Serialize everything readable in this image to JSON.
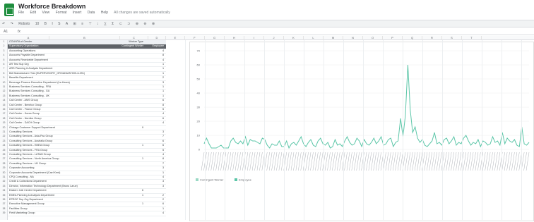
{
  "app": {
    "title": "Workforce Breakdown",
    "menu": [
      "File",
      "Edit",
      "View",
      "Format",
      "Insert",
      "Data",
      "Help"
    ],
    "save_status": "All changes are saved automatically",
    "cell_ref": "A1",
    "fx": "fx"
  },
  "toolbar": {
    "items": [
      "↶",
      "↷",
      "Roboto",
      "10",
      "B",
      "I",
      "S",
      "A",
      "⊞",
      "≡",
      "⊤",
      "↕",
      "∑",
      "Σ",
      "⊂",
      "⊃",
      "⊕",
      "⊖",
      "⊗"
    ]
  },
  "grid": {
    "columns": [
      "A",
      "B",
      "C",
      "D",
      "E",
      "F",
      "G",
      "H",
      "I",
      "J",
      "K",
      "L",
      "M",
      "N",
      "O",
      "P",
      "Q",
      "R",
      "S",
      "T"
    ],
    "rows": [
      {
        "n": "1",
        "a": "COUNTA of Gender",
        "b": "Worker Type",
        "c": ""
      },
      {
        "n": "2",
        "a": "Supervisory Organization",
        "b": "Contingent Worker",
        "c": "Employee"
      },
      {
        "n": "3",
        "a": "Accounting Operations",
        "b": "",
        "c": "4"
      },
      {
        "n": "4",
        "a": "Accounts Payable Department",
        "b": "",
        "c": "8"
      },
      {
        "n": "5",
        "a": "Accounts Receivable Department",
        "b": "",
        "c": "4"
      },
      {
        "n": "6",
        "a": "AR Test Sup Org",
        "b": "",
        "c": "1"
      },
      {
        "n": "7",
        "a": "ARS Planning & Analysis Department",
        "b": "",
        "c": "1"
      },
      {
        "n": "8",
        "a": "Bell Manufacturer Test (SUPERVISORY_ORGANIZATION-6-091)",
        "b": "",
        "c": "1"
      },
      {
        "n": "9",
        "a": "Benefits Department",
        "b": "",
        "c": "2"
      },
      {
        "n": "10",
        "a": "Beverage Finance Executive Department (Ira Heam)",
        "b": "",
        "c": "3"
      },
      {
        "n": "11",
        "a": "Business Services Consulting - FRA",
        "b": "",
        "c": "1"
      },
      {
        "n": "12",
        "a": "Business Services Consulting - GA",
        "b": "",
        "c": "1"
      },
      {
        "n": "13",
        "a": "Business Services Consulting - UK",
        "b": "",
        "c": "1"
      },
      {
        "n": "14",
        "a": "Call Center - AMS Group",
        "b": "",
        "c": "6"
      },
      {
        "n": "15",
        "a": "Call Center - Benelux Group",
        "b": "",
        "c": "8"
      },
      {
        "n": "16",
        "a": "Call Center - France Group",
        "b": "",
        "c": "5"
      },
      {
        "n": "17",
        "a": "Call Center - Korea Group",
        "b": "",
        "c": "4"
      },
      {
        "n": "18",
        "a": "Call Center - Nordics Group",
        "b": "",
        "c": "6"
      },
      {
        "n": "19",
        "a": "Call Center - DACH Group",
        "b": "",
        "c": "4"
      },
      {
        "n": "20",
        "a": "Chicago Customer Support Department",
        "b": "9",
        "c": ""
      },
      {
        "n": "21",
        "a": "Consulting Services",
        "b": "",
        "c": "3"
      },
      {
        "n": "22",
        "a": "Consulting Services - Asia-Pac Group",
        "b": "",
        "c": "7"
      },
      {
        "n": "23",
        "a": "Consulting Services - Australia Group",
        "b": "",
        "c": "6"
      },
      {
        "n": "24",
        "a": "Consulting Services - EMEA Group",
        "b": "1",
        "c": "6"
      },
      {
        "n": "25",
        "a": "Consulting Services - FRA Group",
        "b": "",
        "c": "5"
      },
      {
        "n": "26",
        "a": "Consulting Services - LATAM Group",
        "b": "",
        "c": "4"
      },
      {
        "n": "27",
        "a": "Consulting Services - North America Group",
        "b": "1",
        "c": "8"
      },
      {
        "n": "28",
        "a": "Consulting Services - UK Group",
        "b": "",
        "c": "7"
      },
      {
        "n": "29",
        "a": "Corporate Accounting",
        "b": "",
        "c": "3"
      },
      {
        "n": "30",
        "a": "Corporate Accounts Department (Cael Kent)",
        "b": "",
        "c": "1"
      },
      {
        "n": "31",
        "a": "CPQ Consulting - NA",
        "b": "",
        "c": "4"
      },
      {
        "n": "32",
        "a": "Credit & Collections Department",
        "b": "",
        "c": "3"
      },
      {
        "n": "33",
        "a": "Director, Information Technology Department (Bruno Larue)",
        "b": "",
        "c": "3"
      },
      {
        "n": "34",
        "a": "Eastern Call Center Department",
        "b": "6",
        "c": ""
      },
      {
        "n": "35",
        "a": "EMEA Planning & Analysis Department",
        "b": "1",
        "c": "2"
      },
      {
        "n": "36",
        "a": "EPROF Sup Org Department",
        "b": "",
        "c": "2"
      },
      {
        "n": "37",
        "a": "Executive Management Group",
        "b": "1",
        "c": "6"
      },
      {
        "n": "38",
        "a": "Facilities Group",
        "b": "",
        "c": "1"
      },
      {
        "n": "39",
        "a": "Field Marketing Group",
        "b": "",
        "c": "4"
      }
    ]
  },
  "chart_data": {
    "type": "line",
    "series": [
      {
        "name": "Contingent Worker",
        "color": "#9ad9c5"
      },
      {
        "name": "Employee",
        "color": "#5cc6a8"
      }
    ],
    "ylim": [
      0,
      70
    ],
    "yticks": [
      "70",
      "60",
      "50",
      "40",
      "30",
      "20",
      "10",
      "0"
    ],
    "legend": [
      "Contingent Worker",
      "Employee"
    ],
    "values": [
      4,
      8,
      4,
      1,
      1,
      1,
      2,
      3,
      1,
      1,
      1,
      6,
      8,
      5,
      4,
      6,
      4,
      9,
      3,
      7,
      6,
      6,
      5,
      4,
      8,
      7,
      3,
      1,
      4,
      3,
      3,
      6,
      2,
      2,
      6,
      1,
      4,
      5,
      3,
      6,
      9,
      4,
      2,
      5,
      7,
      3,
      2,
      6,
      8,
      4,
      3,
      5,
      1,
      2,
      7,
      3,
      4,
      2,
      6,
      9,
      5,
      3,
      4,
      8,
      6,
      2,
      7,
      4,
      3,
      5,
      8,
      4,
      6,
      9,
      3,
      4,
      7,
      8,
      2,
      5,
      6,
      22,
      9,
      24,
      60,
      28,
      12,
      16,
      8,
      5,
      7,
      3,
      2,
      4,
      6,
      12,
      4,
      5,
      3,
      7,
      8,
      4,
      6,
      9,
      3,
      5,
      4,
      8,
      10,
      6,
      3,
      5,
      4,
      7,
      2,
      6,
      5,
      3,
      4,
      9,
      5,
      6,
      3,
      12,
      4,
      8,
      6,
      5,
      7,
      3,
      2,
      16,
      4,
      3,
      5
    ]
  }
}
